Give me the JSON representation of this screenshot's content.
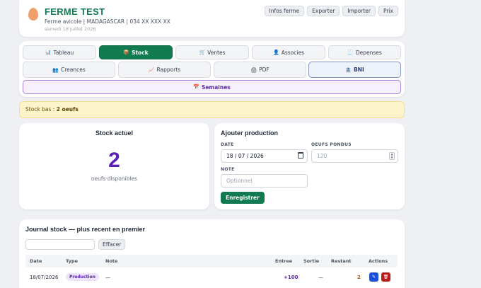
{
  "header": {
    "title": "FERME TEST",
    "subtitle": "Ferme avicole | MADAGASCAR | 034 XX XXX XX",
    "date": "samedi 18 juillet 2026",
    "buttons": [
      "Infos ferme",
      "Exporter",
      "Importer",
      "Prix"
    ]
  },
  "tabs": [
    {
      "label": "Tableau",
      "icon": "chart-icon",
      "glyph": "📊"
    },
    {
      "label": "Stock",
      "icon": "box-icon",
      "glyph": "📦",
      "active": true
    },
    {
      "label": "Ventes",
      "icon": "cart-icon",
      "glyph": "🛒"
    },
    {
      "label": "Associes",
      "icon": "person-icon",
      "glyph": "👤"
    },
    {
      "label": "Depenses",
      "icon": "receipt-icon",
      "glyph": "🧾"
    },
    {
      "label": "Creances",
      "icon": "people-icon",
      "glyph": "👥"
    },
    {
      "label": "Rapports",
      "icon": "trend-icon",
      "glyph": "📈"
    },
    {
      "label": "PDF",
      "icon": "printer-icon",
      "glyph": "🖨"
    },
    {
      "label": "BNI",
      "icon": "bank-icon",
      "glyph": "🏦"
    },
    {
      "label": "Semaines",
      "icon": "calendar-icon",
      "glyph": "📅"
    }
  ],
  "alert": {
    "prefix": "Stock bas :",
    "value": "2 oeufs"
  },
  "stock": {
    "title": "Stock actuel",
    "value": "2",
    "unit": "oeufs disponibles"
  },
  "production": {
    "title": "Ajouter production",
    "date_label": "DATE",
    "date_value": "18 / 07 / 2026",
    "eggs_label": "OEUFS PONDUS",
    "eggs_placeholder": "120",
    "note_label": "NOTE",
    "note_placeholder": "Optionnel",
    "save_label": "Enregistrer"
  },
  "journal": {
    "title": "Journal stock — plus recent en premier",
    "clear_label": "Effacer",
    "columns": {
      "date": "Date",
      "type": "Type",
      "note": "Note",
      "in": "Entree",
      "out": "Sortie",
      "rest": "Restant",
      "actions": "Actions"
    },
    "rows": [
      {
        "date": "18/07/2026",
        "type": "Production",
        "note": "—",
        "in": "+100",
        "out": "—",
        "rest": "2",
        "edit": "✎",
        "delete": "🗑"
      }
    ]
  },
  "colors": {
    "brand": "#127a50",
    "accent": "#5b21b6",
    "alert_bg": "#fdf4c9"
  }
}
